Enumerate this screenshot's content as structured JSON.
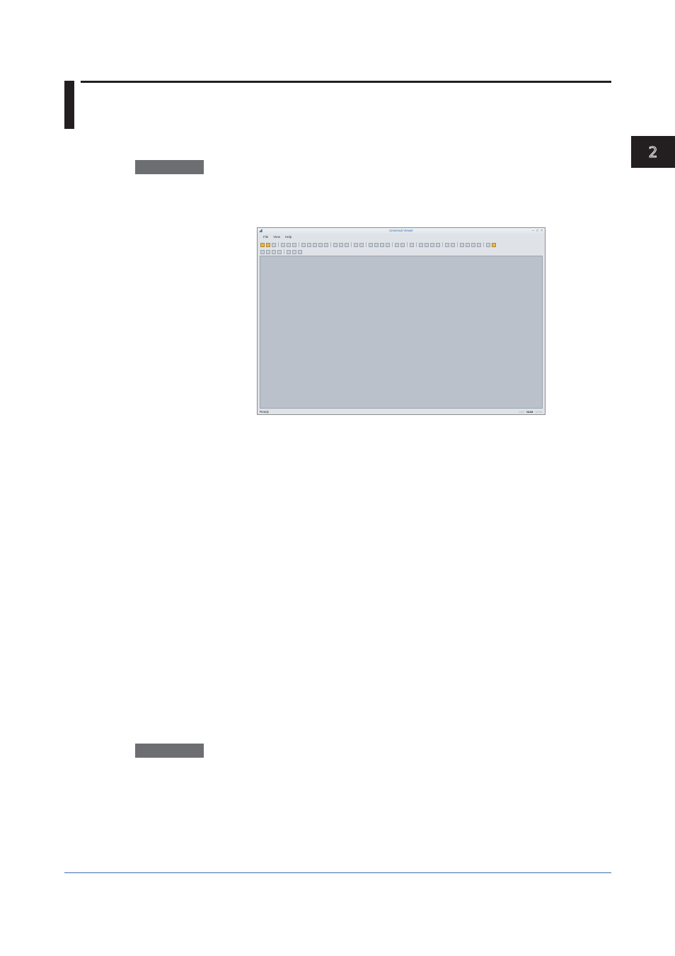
{
  "chapter": {
    "number": "2"
  },
  "app_window": {
    "title": "Universal Viewer",
    "menu": [
      "File",
      "View",
      "Help"
    ],
    "window_controls": [
      "minimize-icon",
      "maximize-icon",
      "close-icon"
    ],
    "toolbar_row1_groups": [
      3,
      3,
      5,
      3,
      2,
      4,
      2,
      1,
      4,
      2,
      4,
      2
    ],
    "toolbar_row2_groups": [
      4,
      3
    ],
    "status": {
      "ready": "Ready",
      "caps": "CAP",
      "num": "NUM",
      "scrl": "SCRL"
    },
    "colors": {
      "client_area": "#bac1ca",
      "title_text": "#3a6fb0"
    }
  },
  "colors": {
    "heading": "#231f20",
    "section_tag": "#6d6e71",
    "footer_rule": "#3d6ab3"
  }
}
